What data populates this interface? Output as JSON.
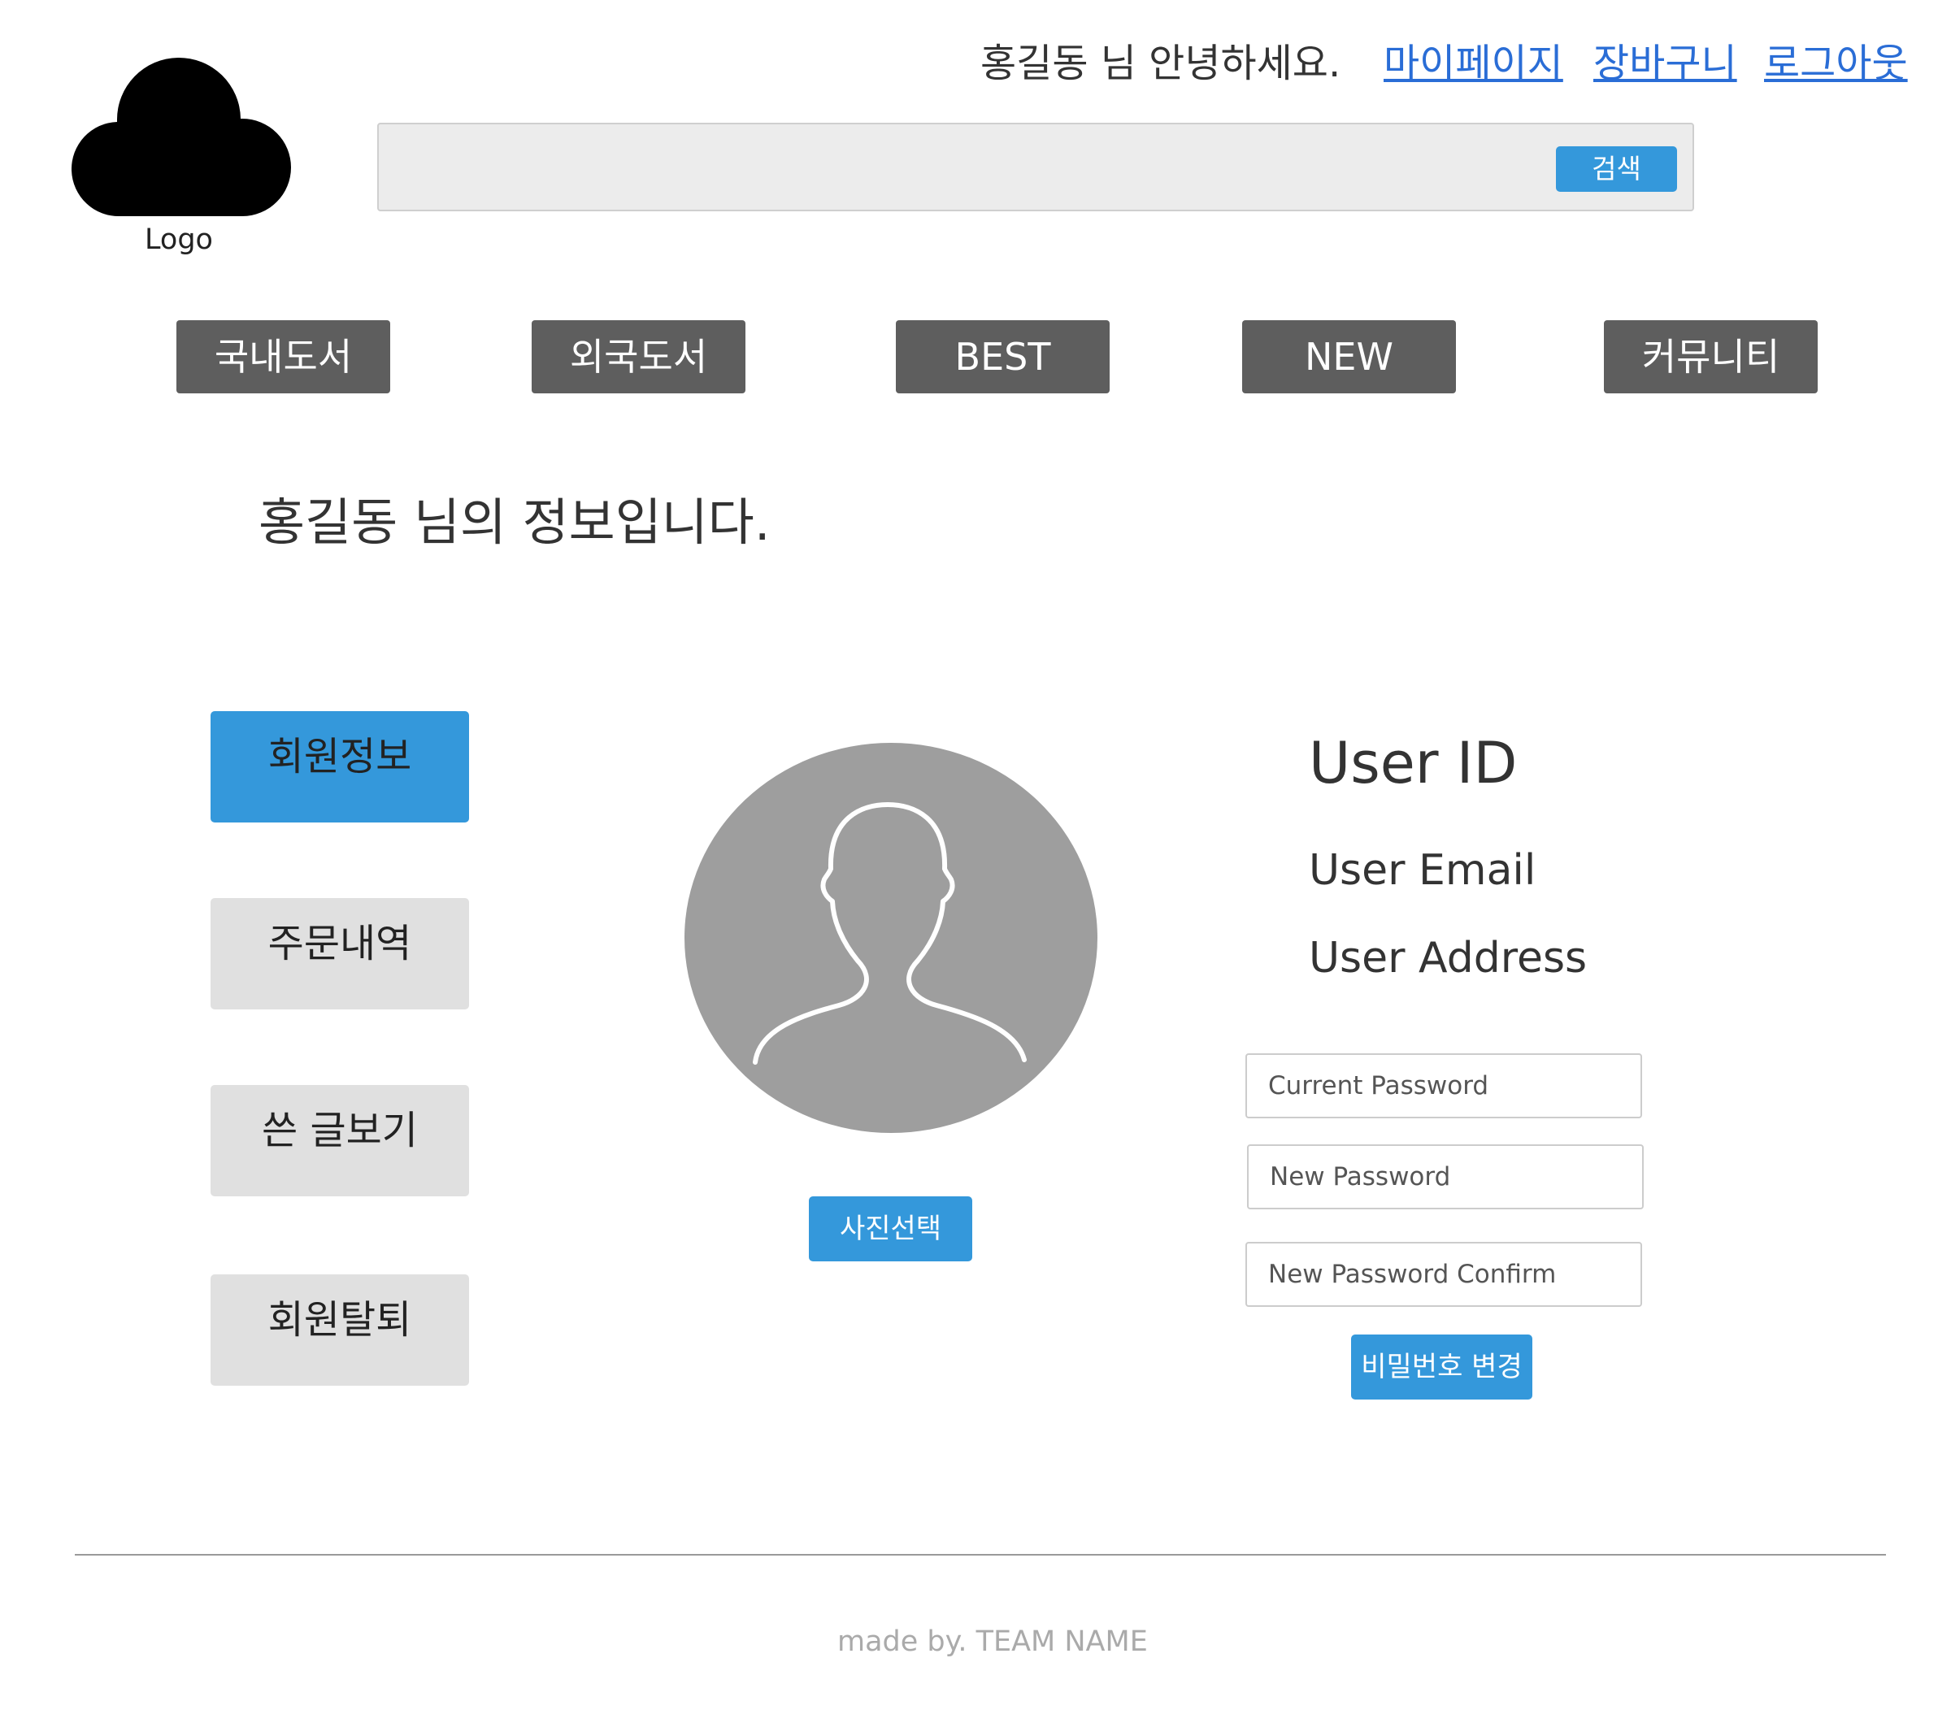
{
  "header": {
    "logo_label": "Logo",
    "greeting": "홍길동 님 안녕하세요.",
    "links": {
      "mypage": "마이페이지",
      "cart": "장바구니",
      "logout": "로그아웃"
    },
    "search": {
      "value": "",
      "button_label": "검색"
    }
  },
  "nav": {
    "domestic": "국내도서",
    "foreign": "외국도서",
    "best": "BEST",
    "new": "NEW",
    "community": "커뮤니티"
  },
  "main": {
    "title": "홍길동 님의 정보입니다.",
    "side_menu": {
      "member_info": "회원정보",
      "order_history": "주문내역",
      "my_posts": "쓴 글보기",
      "withdraw": "회원탈퇴"
    },
    "photo_button": "사진선택",
    "user": {
      "id": "User ID",
      "email": "User Email",
      "address": "User Address"
    },
    "password": {
      "current_placeholder": "Current Password",
      "new_placeholder": "New Password",
      "confirm_placeholder": "New Password Confirm",
      "change_button": "비밀번호 변경"
    }
  },
  "footer": {
    "text": "made by. TEAM NAME"
  },
  "colors": {
    "accent": "#3498db",
    "nav_bg": "#5e5e5e",
    "side_inactive": "#e0e0e0",
    "link": "#2a6dd6",
    "avatar_bg": "#9e9e9e"
  },
  "icons": {
    "logo": "cloud-icon",
    "avatar": "user-silhouette-icon"
  }
}
